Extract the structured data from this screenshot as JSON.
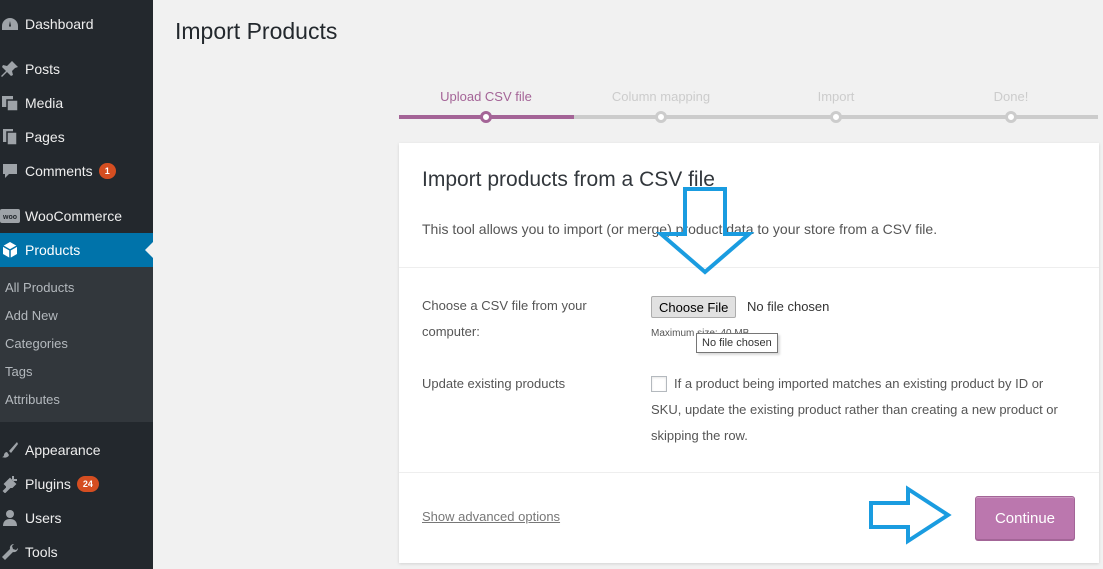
{
  "sidebar": {
    "items": [
      {
        "label": "Dashboard",
        "icon": "dashboard-icon"
      },
      {
        "label": "Posts",
        "icon": "pin-icon"
      },
      {
        "label": "Media",
        "icon": "media-icon"
      },
      {
        "label": "Pages",
        "icon": "pages-icon"
      },
      {
        "label": "Comments",
        "icon": "comment-icon",
        "badge": "1"
      },
      {
        "label": "WooCommerce",
        "icon": "woocommerce-icon"
      },
      {
        "label": "Products",
        "icon": "box-icon"
      },
      {
        "label": "Appearance",
        "icon": "brush-icon"
      },
      {
        "label": "Plugins",
        "icon": "plug-icon",
        "badge": "24"
      },
      {
        "label": "Users",
        "icon": "user-icon"
      },
      {
        "label": "Tools",
        "icon": "wrench-icon"
      }
    ],
    "submenu": [
      "All Products",
      "Add New",
      "Categories",
      "Tags",
      "Attributes"
    ]
  },
  "page": {
    "title": "Import Products"
  },
  "steps": [
    {
      "label": "Upload CSV file",
      "active": true
    },
    {
      "label": "Column mapping",
      "active": false
    },
    {
      "label": "Import",
      "active": false
    },
    {
      "label": "Done!",
      "active": false
    }
  ],
  "card": {
    "heading": "Import products from a CSV file",
    "description": "This tool allows you to import (or merge) product data to your store from a CSV file.",
    "file_label": "Choose a CSV file from your computer:",
    "choose_button": "Choose File",
    "no_file": "No file chosen",
    "max_size": "Maximum size: 40 MB",
    "tooltip": "No file chosen",
    "update_label": "Update existing products",
    "update_desc": "If a product being imported matches an existing product by ID or SKU, update the existing product rather than creating a new product or skipping the row.",
    "advanced_link": "Show advanced options",
    "continue_button": "Continue"
  },
  "colors": {
    "sidebar_bg": "#23282d",
    "active_menu": "#0073aa",
    "woo_purple": "#a46497",
    "continue_bg": "#bb77ae",
    "annotation_arrow": "#1a9ce0"
  }
}
